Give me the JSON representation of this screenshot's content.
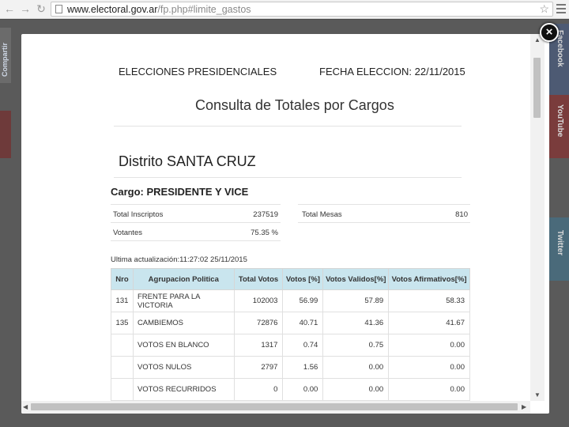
{
  "browser": {
    "url_host": "www.electoral.gov.ar",
    "url_path": "/fp.php#limite_gastos"
  },
  "background": {
    "share_left": "Compartir",
    "share_right": [
      "Facebook",
      "YouTube",
      "Twitter"
    ]
  },
  "report": {
    "header_left": "ELECCIONES PRESIDENCIALES",
    "header_right": "FECHA ELECCION: 22/11/2015",
    "title": "Consulta de Totales por Cargos",
    "district": "Distrito SANTA CRUZ",
    "cargo": "Cargo: PRESIDENTE Y VICE",
    "stats": {
      "total_inscriptos_label": "Total Inscriptos",
      "total_inscriptos_value": "237519",
      "total_mesas_label": "Total Mesas",
      "total_mesas_value": "810",
      "votantes_label": "Votantes",
      "votantes_value": "75.35 %"
    },
    "updated": "Ultima actualización:11:27:02 25/11/2015",
    "table": {
      "headers": [
        "Nro",
        "Agrupacion Politica",
        "Total Votos",
        "Votos [%]",
        "Votos Validos[%]",
        "Votos Afirmativos[%]"
      ],
      "rows": [
        [
          "131",
          "FRENTE PARA LA VICTORIA",
          "102003",
          "56.99",
          "57.89",
          "58.33"
        ],
        [
          "135",
          "CAMBIEMOS",
          "72876",
          "40.71",
          "41.36",
          "41.67"
        ],
        [
          "",
          "VOTOS EN BLANCO",
          "1317",
          "0.74",
          "0.75",
          "0.00"
        ],
        [
          "",
          "VOTOS NULOS",
          "2797",
          "1.56",
          "0.00",
          "0.00"
        ],
        [
          "",
          "VOTOS RECURRIDOS",
          "0",
          "0.00",
          "0.00",
          "0.00"
        ]
      ]
    }
  },
  "close_symbol": "×"
}
